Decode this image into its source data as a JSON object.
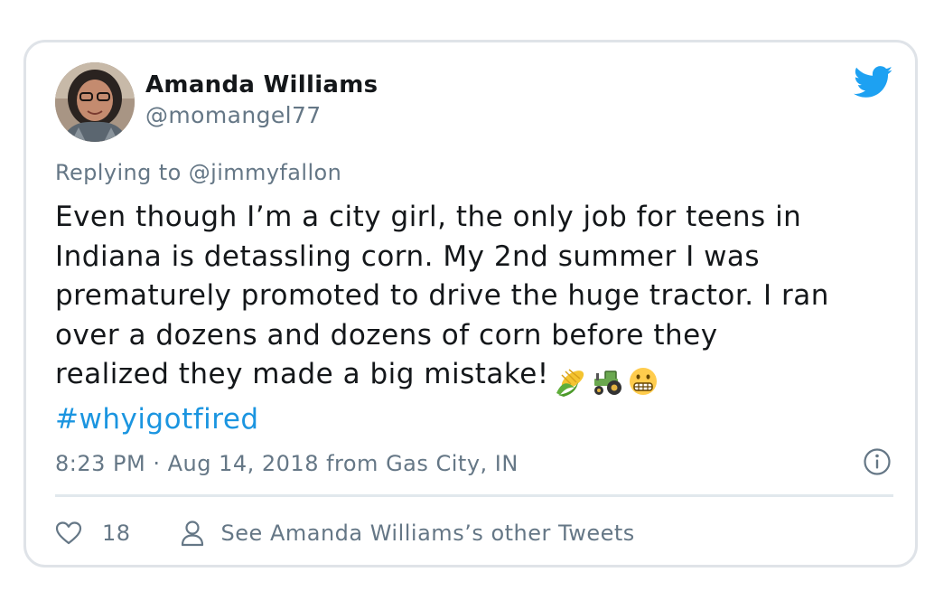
{
  "author": {
    "name": "Amanda Williams",
    "handle": "@momangel77"
  },
  "reply_to": "Replying to @jimmyfallon",
  "tweet": {
    "lines": [
      "Even though I’m a city girl, the only job for teens in",
      "Indiana is detassling corn. My 2nd summer I was",
      "prematurely promoted to drive the huge tractor. I ran",
      "over a dozens and dozens of corn before they",
      "realized they made a big mistake!"
    ],
    "emojis": [
      "corn",
      "tractor",
      "grimacing-face"
    ],
    "hashtag": "#whyigotfired"
  },
  "meta": {
    "timestamp": "8:23 PM · Aug 14, 2018 from Gas City, IN"
  },
  "actions": {
    "like_count": "18",
    "other_tweets_label": "See Amanda Williams’s other Tweets"
  },
  "colors": {
    "link": "#1b95e0",
    "muted": "#657786",
    "twitter_blue": "#1da1f2",
    "border": "#dfe3e8"
  }
}
